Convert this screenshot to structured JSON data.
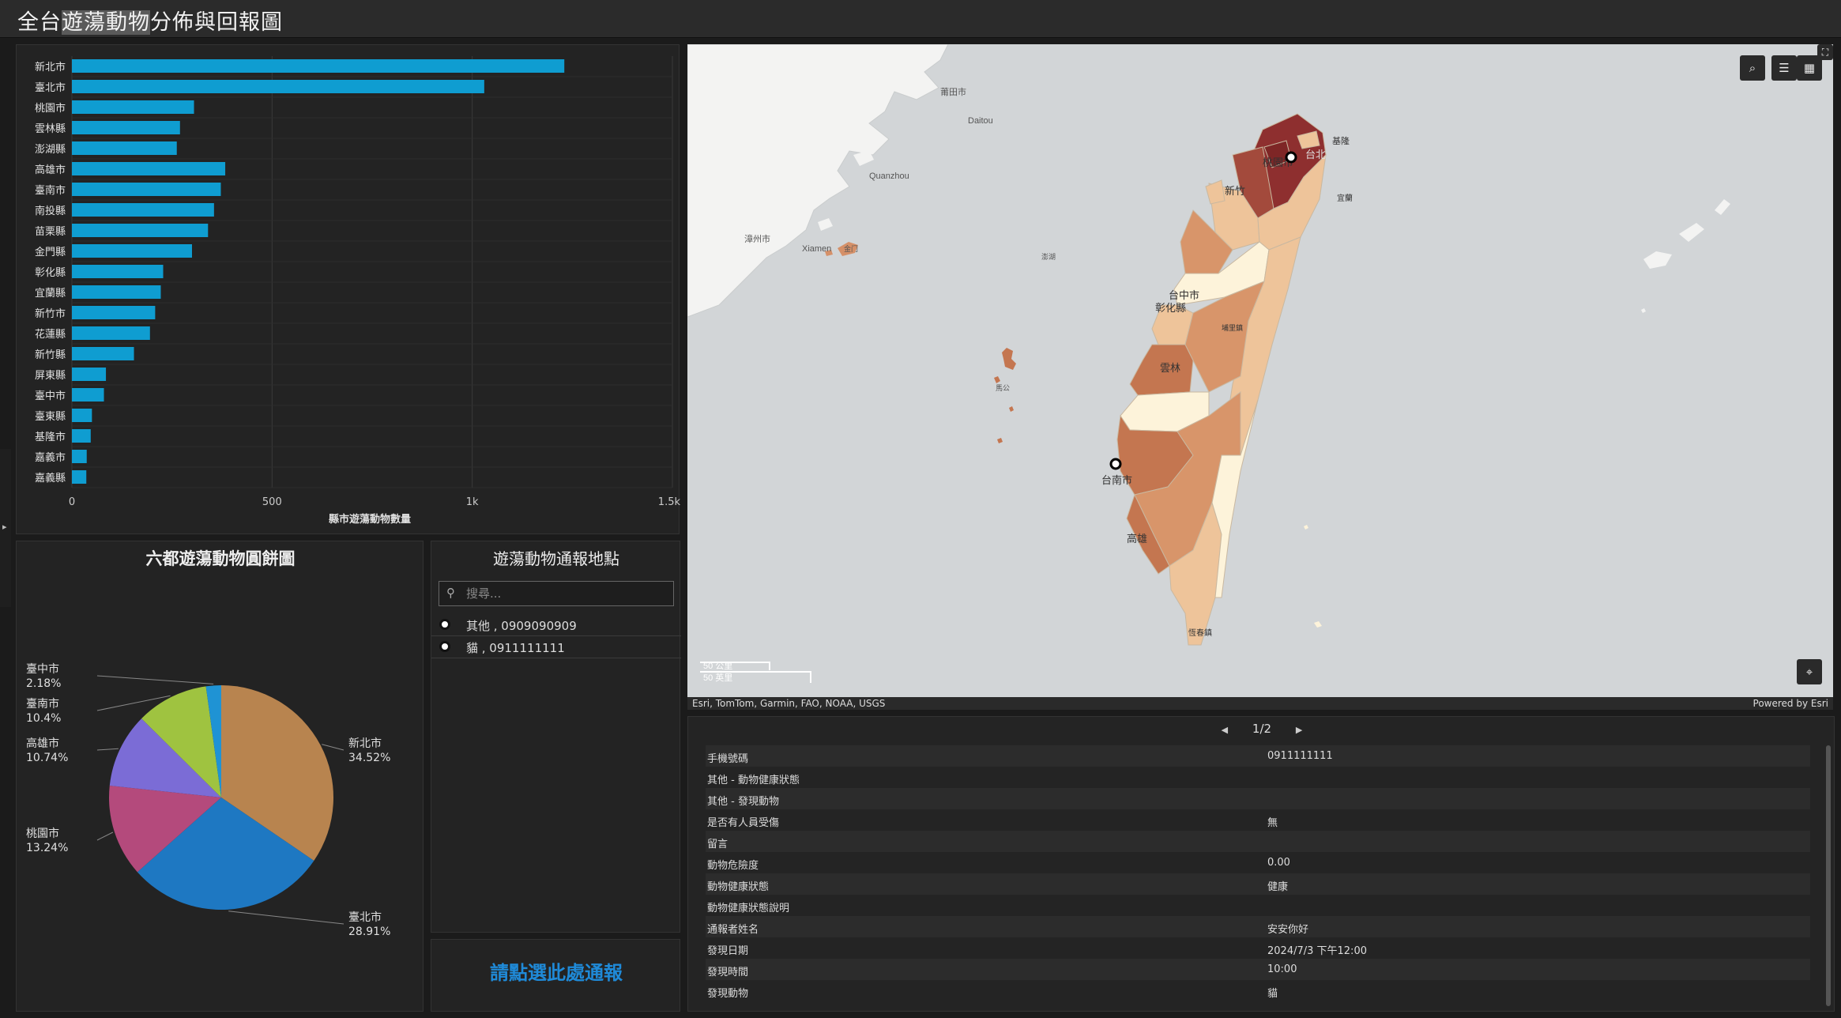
{
  "header": {
    "title_pre": "全台",
    "title_highlight": "遊蕩動物",
    "title_post": "分佈與回報圖"
  },
  "side_tab": {
    "glyph": "▸"
  },
  "bar_chart": {
    "chart_data": {
      "type": "bar",
      "orientation": "horizontal",
      "categories": [
        "新北市",
        "臺北市",
        "桃園市",
        "雲林縣",
        "澎湖縣",
        "高雄市",
        "臺南市",
        "南投縣",
        "苗栗縣",
        "金門縣",
        "彰化縣",
        "宜蘭縣",
        "新竹市",
        "花蓮縣",
        "新竹縣",
        "屏東縣",
        "臺中市",
        "臺東縣",
        "基隆市",
        "嘉義市",
        "嘉義縣"
      ],
      "values": [
        1230,
        1030,
        305,
        270,
        262,
        383,
        372,
        355,
        340,
        300,
        228,
        222,
        208,
        195,
        155,
        85,
        80,
        50,
        47,
        37,
        36
      ],
      "xlabel": "縣市遊蕩動物數量",
      "xlim": [
        0,
        1500
      ],
      "xticks": [
        "0",
        "500",
        "1k",
        "1.5k"
      ],
      "color": "#0f9dd1",
      "grid": true
    }
  },
  "pie_chart": {
    "title": "六都遊蕩動物圓餅圖",
    "chart_data": {
      "type": "pie",
      "slices": [
        {
          "label": "新北市",
          "percent": 34.52,
          "display": "34.52%",
          "color": "#b8844f"
        },
        {
          "label": "臺北市",
          "percent": 28.91,
          "display": "28.91%",
          "color": "#1e78c2"
        },
        {
          "label": "桃園市",
          "percent": 13.24,
          "display": "13.24%",
          "color": "#b44a7c"
        },
        {
          "label": "高雄市",
          "percent": 10.74,
          "display": "10.74%",
          "color": "#7b6cd6"
        },
        {
          "label": "臺南市",
          "percent": 10.4,
          "display": "10.4%",
          "color": "#9fc340"
        },
        {
          "label": "臺中市",
          "percent": 2.18,
          "display": "2.18%",
          "color": "#1f93d4"
        }
      ]
    }
  },
  "report_list": {
    "title": "遊蕩動物通報地點",
    "search_placeholder": "搜尋...",
    "items": [
      {
        "label": "其他 , 0909090909"
      },
      {
        "label": "貓 , 0911111111"
      }
    ]
  },
  "report_link": {
    "label": "請點選此處通報"
  },
  "map": {
    "labels": {
      "putian": "莆田市",
      "daitou": "Daitou",
      "quanzhou": "Quanzhou",
      "zhangzhou": "漳州市",
      "xiamen": "Xiamen",
      "kinmen": "金门",
      "penghu": "馬公",
      "unk1": "澎湖",
      "taoyuan": "桃園市",
      "taipei": "台北",
      "keelung": "基隆",
      "yilan": "宜蘭",
      "hsinchu": "新竹",
      "taichung": "台中市",
      "changhua": "彰化縣",
      "nantou": "埔里鎮",
      "yunlin": "雲林",
      "tainan": "台南市",
      "kaohsiung": "高雄",
      "hengchun": "恆春鎮"
    },
    "scale": {
      "km": "50 公里",
      "mi": "50 英里"
    },
    "colors": {
      "sea": "#d2d5d7",
      "land": "#f3f3f2",
      "dark": "#8e2f2f",
      "mid": "#c47650",
      "light": "#eec49a",
      "pale": "#fdf3da"
    }
  },
  "map_controls": {
    "search_icon": "⌕",
    "list_icon": "☰",
    "grid_icon": "▦",
    "locate_icon": "⌖",
    "expand_icon": "⛶"
  },
  "attribution": {
    "left": "Esri, TomTom, Garmin, FAO, NOAA, USGS",
    "right": "Powered by Esri"
  },
  "popup": {
    "pager": "1/2",
    "prev": "◀",
    "next": "▶",
    "rows": [
      {
        "k": "手機號碼",
        "v": "0911111111"
      },
      {
        "k": "其他 - 動物健康狀態",
        "v": ""
      },
      {
        "k": "其他 - 發現動物",
        "v": ""
      },
      {
        "k": "是否有人員受傷",
        "v": "無"
      },
      {
        "k": "留言",
        "v": ""
      },
      {
        "k": "動物危險度",
        "v": "0.00"
      },
      {
        "k": "動物健康狀態",
        "v": "健康"
      },
      {
        "k": "動物健康狀態說明",
        "v": ""
      },
      {
        "k": "通報者姓名",
        "v": "安安你好"
      },
      {
        "k": "發現日期",
        "v": "2024/7/3 下午12:00"
      },
      {
        "k": "發現時間",
        "v": "10:00"
      },
      {
        "k": "發現動物",
        "v": "貓"
      }
    ]
  }
}
